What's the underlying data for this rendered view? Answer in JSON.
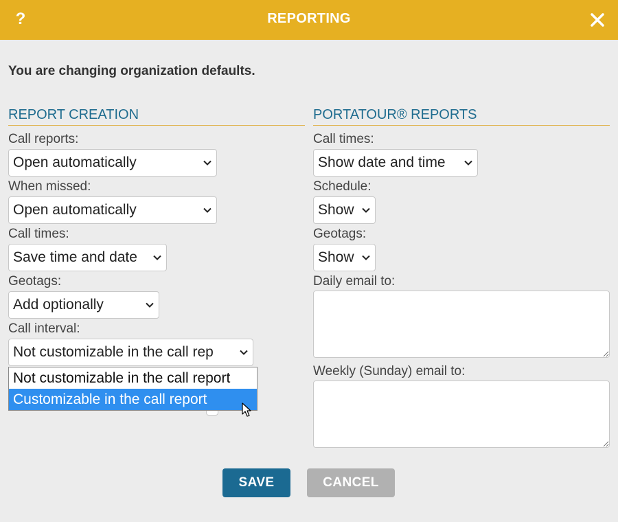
{
  "dialog": {
    "help_label": "?",
    "title": "REPORTING"
  },
  "notice": "You are changing organization defaults.",
  "report_creation": {
    "heading": "REPORT CREATION",
    "call_reports_label": "Call reports:",
    "call_reports_value": "Open automatically",
    "when_missed_label": "When missed:",
    "when_missed_value": "Open automatically",
    "call_times_label": "Call times:",
    "call_times_value": "Save time and date",
    "geotags_label": "Geotags:",
    "geotags_value": "Add optionally",
    "call_interval_label": "Call interval:",
    "call_interval_value": "Not customizable in the call rep",
    "call_interval_options": [
      "Not customizable in the call report",
      "Customizable in the call report"
    ]
  },
  "portatour_reports": {
    "heading": "PORTATOUR® REPORTS",
    "call_times_label": "Call times:",
    "call_times_value": "Show date and time",
    "schedule_label": "Schedule:",
    "schedule_value": "Show",
    "geotags_label": "Geotags:",
    "geotags_value": "Show",
    "daily_email_label": "Daily email to:",
    "daily_email_value": "",
    "weekly_email_label": "Weekly (Sunday) email to:",
    "weekly_email_value": ""
  },
  "buttons": {
    "save": "SAVE",
    "cancel": "CANCEL"
  },
  "colors": {
    "titlebar": "#e6b022",
    "section_heading": "#1f6c8f",
    "save_button": "#1b6a92",
    "cancel_button": "#b1b1b1",
    "selected_option": "#2f8fef"
  },
  "icons": [
    "help-icon",
    "close-icon",
    "chevron-down-icon",
    "mouse-cursor-icon"
  ]
}
